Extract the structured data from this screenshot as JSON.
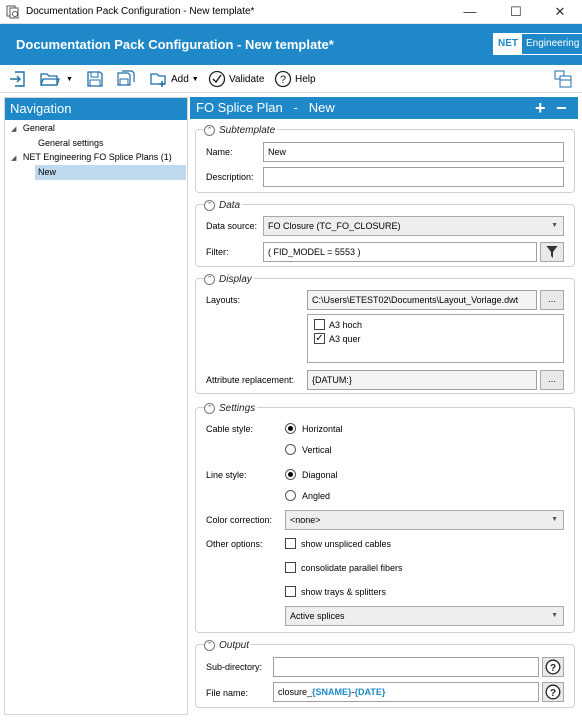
{
  "window": {
    "title": "Documentation Pack Configuration - New template*",
    "minimize_glyph": "—",
    "maximize_glyph": "☐",
    "close_glyph": "✕"
  },
  "header": {
    "title": "Documentation Pack Configuration - New template*",
    "logo_net": "NET",
    "logo_engineering": "Engineering"
  },
  "toolbar": {
    "add_label": "Add",
    "validate_label": "Validate",
    "help_label": "Help"
  },
  "navigation": {
    "title": "Navigation",
    "general": "General",
    "general_settings": "General settings",
    "splice_plans": "NET Engineering FO Splice Plans (1)",
    "new_item": "New"
  },
  "main": {
    "title": "FO Splice Plan   -   New",
    "add_glyph": "+",
    "remove_glyph": "−"
  },
  "subtemplate": {
    "heading": "Subtemplate",
    "name_label": "Name:",
    "name_value": "New",
    "description_label": "Description:",
    "description_value": ""
  },
  "data": {
    "heading": "Data",
    "source_label": "Data source:",
    "source_value": "FO Closure (TC_FO_CLOSURE)",
    "filter_label": "Filter:",
    "filter_value": "( FID_MODEL = 5553 )"
  },
  "display": {
    "heading": "Display",
    "layouts_label": "Layouts:",
    "layouts_value": "C:\\Users\\ETEST02\\Documents\\Layout_Vorlage.dwt",
    "browse_label": "...",
    "layout_options": [
      {
        "label": "A3 hoch",
        "checked": false
      },
      {
        "label": "A3 quer",
        "checked": true
      }
    ],
    "attr_label": "Attribute replacement:",
    "attr_value": "{DATUM:}"
  },
  "settings": {
    "heading": "Settings",
    "cable_style_label": "Cable style:",
    "cable_horizontal": "Horizontal",
    "cable_vertical": "Vertical",
    "line_style_label": "Line style:",
    "line_diagonal": "Diagonal",
    "line_angled": "Angled",
    "color_label": "Color correction:",
    "color_value": "<none>",
    "other_label": "Other options:",
    "opt_unspliced": "show unspliced cables",
    "opt_parallel": "consolidate parallel fibers",
    "opt_trays": "show trays & splitters",
    "splices_value": "Active splices"
  },
  "output": {
    "heading": "Output",
    "subdir_label": "Sub-directory:",
    "subdir_value": "",
    "filename_label": "File name:",
    "filename_prefix": "closure_",
    "filename_sname": "{SNAME}",
    "filename_sep": "-",
    "filename_date": "{DATE}",
    "help_glyph": "?"
  },
  "colors": {
    "accent": "#1e88c8",
    "selection": "#bfd9ee"
  }
}
